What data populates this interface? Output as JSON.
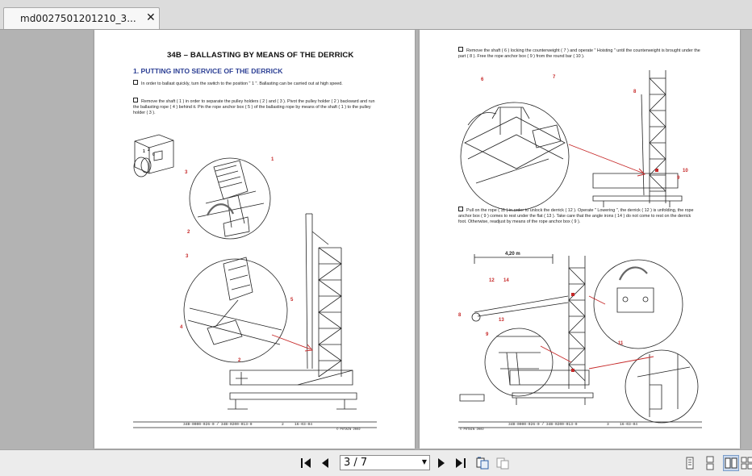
{
  "tab": {
    "title": "md0027501201210_3...",
    "close": "✕"
  },
  "toolbar": {
    "page_indicator": "3 / 7"
  },
  "left_page": {
    "title": "34B – BALLASTING BY MEANS OF THE DERRICK",
    "section": "1. PUTTING INTO SERVICE OF THE DERRICK",
    "para1": "In order to ballast quickly, turn the switch to the position \" 1 \". Ballasting can be carried out at high speed.",
    "para2": "Remove the shaft ( 1 ) in order to separate the pulley holders ( 2 ) and ( 3 ). Pivot the pulley holder ( 2 ) backward and run the ballasting rope ( 4 ) behind it. Pin the rope anchor box ( 5 ) of the ballasting rope by means of the shaft ( 1 ) to the pulley holder ( 3 ).",
    "callouts": [
      "1",
      "2",
      "3",
      "3",
      "4",
      "5",
      "2"
    ],
    "switch_labels": [
      "1",
      "2",
      "0"
    ],
    "footer_code": "34B-0000-026-0 / 34B-0200-013-0",
    "footer_page": "2",
    "footer_date": "16-03-04",
    "copyright": "© POTAIN 2002"
  },
  "right_page": {
    "para1": "Remove the shaft ( 6 ) locking the counterweight ( 7 ) and operate \" Hoisting \" until the counterweight is brought under the part ( 8 ). Free  the rope anchor box ( 9 ) from the round bar ( 10 ).",
    "para2": "Pull on the rope ( 11 ) in order to unlock the derrick ( 12 ). Operate \" Lowering \", the derrick ( 12 ) is unfolding, the rope anchor box ( 9 ) comes to rest under the flat ( 13 ). Take care that the angle irons ( 14 ) do not come to rest on the derrick foot. Otherwise, readjust by means of the rope anchor box ( 9 ).",
    "callouts_top": [
      "6",
      "7",
      "8",
      "10",
      "9"
    ],
    "callouts_bottom": [
      "12",
      "14",
      "8",
      "9",
      "13",
      "11"
    ],
    "dimension": "4,20 m",
    "footer_code": "34B-0000-026-0 / 34B-0200-013-0",
    "footer_page": "3",
    "footer_date": "16-03-04",
    "copyright": "© POTAIN 2002"
  },
  "colors": {
    "accent_blue": "#2c3f94",
    "callout_red": "#c62828",
    "viewer_bg": "#b3b3b3"
  },
  "icons": [
    "first-page-icon",
    "prev-page-icon",
    "next-page-icon",
    "last-page-icon",
    "fit-page-icon",
    "fit-width-icon",
    "single-page-icon",
    "continuous-page-icon",
    "two-page-icon",
    "two-page-continuous-icon"
  ]
}
